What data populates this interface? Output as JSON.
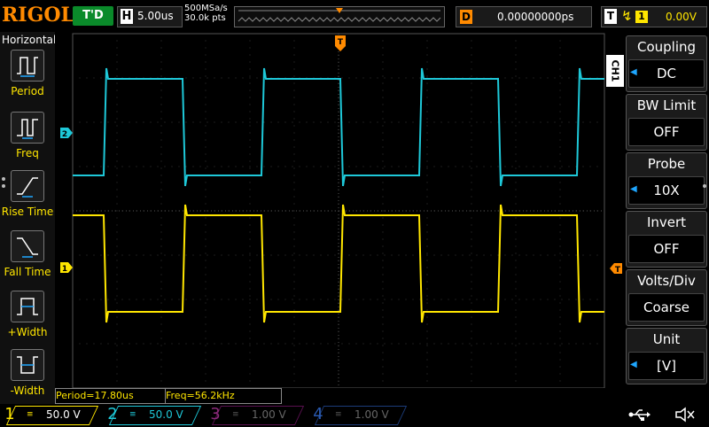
{
  "brand": "RIGOL",
  "topbar": {
    "trigger_status": "T'D",
    "horizontal_label": "H",
    "timebase": "5.00us",
    "sample_rate": "500MSa/s",
    "memory_depth": "30.0k pts",
    "delay_label": "D",
    "delay_value": "0.00000000ps",
    "trigger_label": "T",
    "trigger_source": "1",
    "trigger_level": "0.00V"
  },
  "left_panel": {
    "title": "Horizontal",
    "buttons": [
      {
        "label": "Period",
        "icon": "period-icon"
      },
      {
        "label": "Freq",
        "icon": "frequency-icon"
      },
      {
        "label": "Rise Time",
        "icon": "rise-time-icon"
      },
      {
        "label": "Fall Time",
        "icon": "fall-time-icon"
      },
      {
        "label": "+Width",
        "icon": "positive-width-icon"
      },
      {
        "label": "-Width",
        "icon": "negative-width-icon"
      }
    ]
  },
  "right_panel": {
    "channel_tab": "CH1",
    "items": [
      {
        "title": "Coupling",
        "value": "DC"
      },
      {
        "title": "BW Limit",
        "value": "OFF"
      },
      {
        "title": "Probe",
        "value": "10X"
      },
      {
        "title": "Invert",
        "value": "OFF"
      },
      {
        "title": "Volts/Div",
        "value": "Coarse"
      },
      {
        "title": "Unit",
        "value": "[V]"
      }
    ]
  },
  "markers": {
    "ch1": "1",
    "ch2": "2",
    "trigger_pos": "T",
    "trigger_level_marker": "T"
  },
  "measurements": {
    "period": "Period=17.80us",
    "freq": "Freq=56.2kHz"
  },
  "channels": [
    {
      "num": "1",
      "scale": "50.0 V",
      "color": "#ffe600",
      "active": true
    },
    {
      "num": "2",
      "scale": "50.0 V",
      "color": "#1ec8d8",
      "active": true
    },
    {
      "num": "3",
      "scale": "1.00 V",
      "color": "#b0208c",
      "active": false
    },
    {
      "num": "4",
      "scale": "1.00 V",
      "color": "#2a6cd8",
      "active": false
    }
  ],
  "colors": {
    "ch1": "#ffe600",
    "ch2": "#1ec8d8",
    "trigger": "#ff8a00",
    "accent": "#1ea6ff"
  }
}
